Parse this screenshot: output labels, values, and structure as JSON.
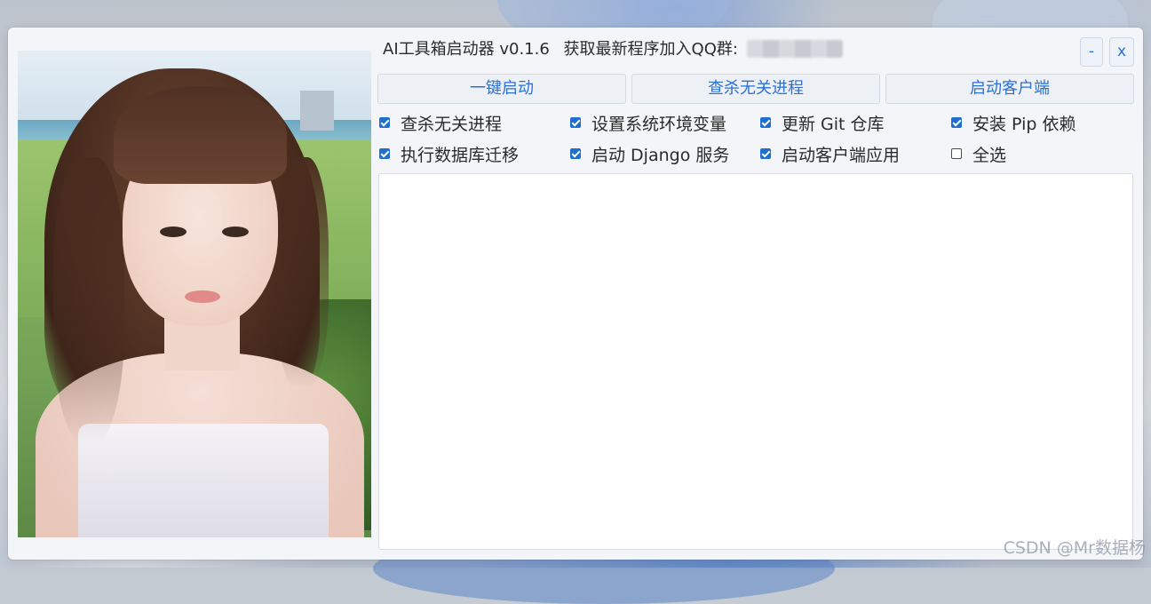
{
  "window": {
    "title": "AI工具箱启动器 v0.1.6",
    "qq_prompt": "获取最新程序加入QQ群:",
    "minimize_label": "-",
    "close_label": "x"
  },
  "actions": {
    "one_click_start": "一键启动",
    "kill_processes": "查杀无关进程",
    "start_client": "启动客户端"
  },
  "options": [
    {
      "label": "查杀无关进程",
      "checked": true
    },
    {
      "label": "设置系统环境变量",
      "checked": true
    },
    {
      "label": "更新 Git 仓库",
      "checked": true
    },
    {
      "label": "安装 Pip 依赖",
      "checked": true
    },
    {
      "label": "执行数据库迁移",
      "checked": true
    },
    {
      "label": "启动 Django 服务",
      "checked": true
    },
    {
      "label": "启动客户端应用",
      "checked": true
    },
    {
      "label": "全选",
      "checked": false
    }
  ],
  "log": {
    "content": ""
  },
  "watermark": "CSDN @Mr数据杨",
  "colors": {
    "accent": "#2c6fd6",
    "checkbox": "#1f6fd1",
    "window_bg": "#f3f5f8"
  }
}
